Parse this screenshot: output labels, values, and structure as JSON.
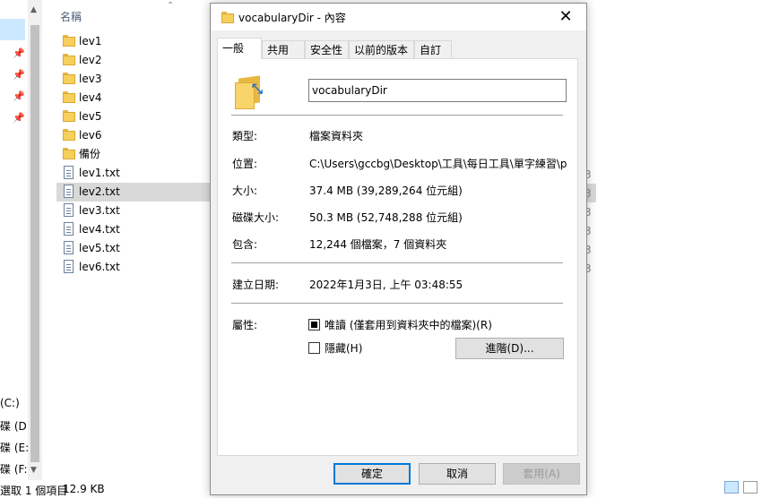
{
  "explorer": {
    "column_header": "名稱",
    "files": [
      {
        "name": "lev1",
        "type": "folder"
      },
      {
        "name": "lev2",
        "type": "folder"
      },
      {
        "name": "lev3",
        "type": "folder"
      },
      {
        "name": "lev4",
        "type": "folder"
      },
      {
        "name": "lev5",
        "type": "folder"
      },
      {
        "name": "lev6",
        "type": "folder"
      },
      {
        "name": "備份",
        "type": "folder"
      },
      {
        "name": "lev1.txt",
        "type": "txt"
      },
      {
        "name": "lev2.txt",
        "type": "txt",
        "selected": true
      },
      {
        "name": "lev3.txt",
        "type": "txt"
      },
      {
        "name": "lev4.txt",
        "type": "txt"
      },
      {
        "name": "lev5.txt",
        "type": "txt"
      },
      {
        "name": "lev6.txt",
        "type": "txt"
      }
    ],
    "drives": [
      "(C:)",
      "碟 (D:)",
      "碟 (E:)",
      "碟 (F:)"
    ],
    "status_text": "選取 1 個項目",
    "status_size": "12.9 KB"
  },
  "dialog": {
    "title": "vocabularyDir - 內容",
    "close_glyph": "✕",
    "tabs": [
      "一般",
      "共用",
      "安全性",
      "以前的版本",
      "自訂"
    ],
    "active_tab": "一般",
    "folder_name": "vocabularyDir",
    "properties": {
      "type_label": "類型:",
      "type_value": "檔案資料夾",
      "location_label": "位置:",
      "location_value": "C:\\Users\\gccbg\\Desktop\\工具\\每日工具\\單字練習\\p",
      "size_label": "大小:",
      "size_value": "37.4 MB (39,289,264 位元組)",
      "disk_size_label": "磁碟大小:",
      "disk_size_value": "50.3 MB (52,748,288 位元組)",
      "contains_label": "包含:",
      "contains_value": "12,244 個檔案，7 個資料夾",
      "created_label": "建立日期:",
      "created_value": "2022年1月3日, 上午 03:48:55",
      "attributes_label": "屬性:",
      "readonly_label": "唯讀 (僅套用到資料夾中的檔案)(R)",
      "readonly_checked": true,
      "hidden_label": "隱藏(H)",
      "hidden_checked": false,
      "advanced_label": "進階(D)..."
    },
    "buttons": {
      "ok": "確定",
      "cancel": "取消",
      "apply": "套用(A)"
    }
  }
}
